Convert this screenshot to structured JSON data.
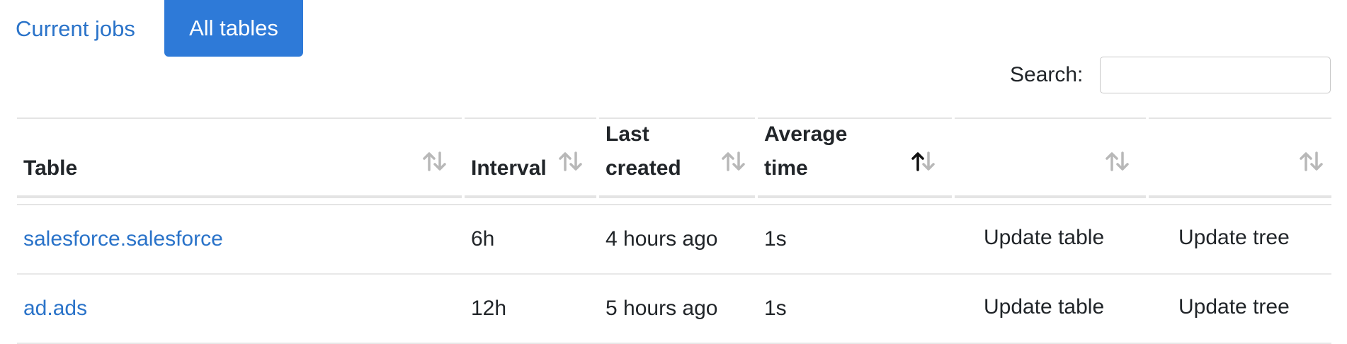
{
  "tabs": {
    "current_jobs": "Current jobs",
    "all_tables": "All tables"
  },
  "search": {
    "label": "Search:",
    "value": "",
    "placeholder": ""
  },
  "table": {
    "columns": [
      "Table",
      "Interval",
      "Last\ncreated",
      "Average\ntime",
      "",
      ""
    ],
    "sorted_column": "Average time",
    "sort_direction": "ascending",
    "rows": [
      {
        "table": "salesforce.salesforce",
        "interval": "6h",
        "last_created": "4 hours ago",
        "average_time": "1s",
        "action_table": "Update table",
        "action_tree": "Update tree"
      },
      {
        "table": "ad.ads",
        "interval": "12h",
        "last_created": "5 hours ago",
        "average_time": "1s",
        "action_table": "Update table",
        "action_tree": "Update tree"
      }
    ]
  },
  "icons": {
    "sort": "sort-icon",
    "sort_active": "sort-ascending-icon"
  },
  "colors": {
    "accent": "#2e7ad8",
    "link": "#2a73c9",
    "sort_inactive": "#b8b8b8",
    "sort_active": "#111111"
  }
}
